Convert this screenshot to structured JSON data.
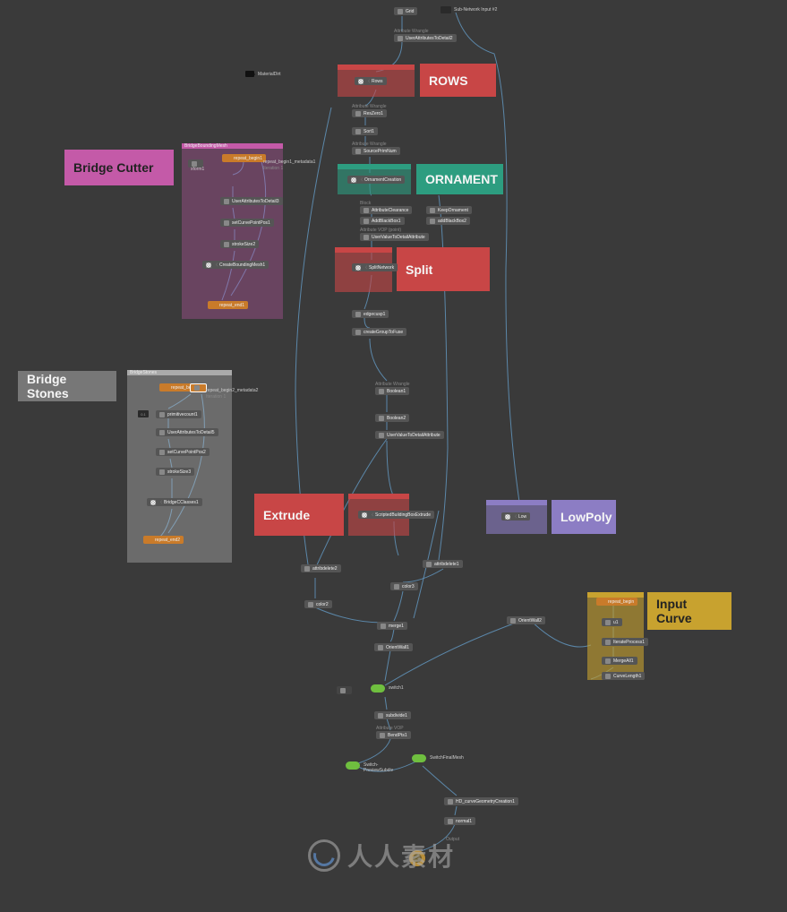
{
  "annotations": {
    "bridge_cutter": "Bridge Cutter",
    "bridge_stones": "Bridge Stones",
    "rows": "ROWS",
    "ornament": "ORNAMENT",
    "split": "Split",
    "extrude": "Extrude",
    "lowpoly": "LowPoly",
    "input_curve": "Input Curve"
  },
  "netbox_titles": {
    "bridge_bounding_mesh": "BridgeBoundingMesh",
    "bridge_stones": "BridgeStones",
    "rows_box": "",
    "ornament_box": "",
    "split_box": "",
    "extrude_l": "",
    "extrude_r": "",
    "lowpoly_box": "",
    "curve_box": ""
  },
  "nodes": {
    "grid": "Grid",
    "sub_input": "Sub-Network Input #2",
    "uva2detail1": "UserAttributesToDetail2",
    "rows": "Rows",
    "resize1": "Attribute Wrangle",
    "resize1b": "ResZero1",
    "sort1": "Sort1",
    "source_prim": "SourcePrimNum",
    "source_prim_lbl": "Attribute Wrangle",
    "ornament_creation": "OrnamentCreation",
    "attribute_clearance": "AttributeClearance",
    "attribute_clearance_lbl": "Block",
    "add_block1": "AddBlackBox1",
    "uva2detail_orn": "UserValueToDetailAttribute",
    "uva2detail_orn_lbl": "Attribute VOP (point)",
    "keep_ornament": "KeepOrnament",
    "add_block2": "addBlackBox2",
    "split_network": "SplitNetwork",
    "edgecusp1": "edgecusp1",
    "createGroupToFuse": "createGroupToFuse",
    "boolean1": "Boolean1",
    "boolean1_lbl": "Attribute Wrangle",
    "boolean2": "Boolean2",
    "uva_bool": "UserValueToDetailAttribute",
    "stashbbe": "ScriptedBuildingBoxExtrude",
    "attribdelete1": "attribdelete1",
    "color2": "color2",
    "attribdelete2": "attribdelete2",
    "color3": "color3",
    "merge1": "merge1",
    "orient_wall1": "OrientWall1",
    "orient_wall2": "OrientWall2",
    "switch1": "switch1",
    "subdivide1": "subdivide1",
    "bend_pts1": "BendPts1",
    "bend_pts1_lbl": "Attribute VOP",
    "switch_preview": "Switch-PreviewSubdiv",
    "switch_final": "SwitchFinalMesh",
    "hdcurve": "HD_curveGeometryCreation1",
    "normal1": "normal1",
    "out_label": "Output",
    "low": "Low",
    "repeat_begin1": "repeat_begin1",
    "rb1_meta": "repeat_begin1_metadata1",
    "rb1_iter": "Iteration 1",
    "xform1": "xform1",
    "uva2detail3": "UserAttributesToDetail3",
    "setcurvepoint1": "setCurvePointPos1",
    "strokesize2": "strokeSize2",
    "createBBmesh": "CreateBoundingMesh1",
    "repeat_end1": "repeat_end1",
    "repeat_begin2": "repeat_begin2",
    "rb2_meta": "repeat_begin2_metadata2",
    "rb2_iter": "Iteration 1",
    "primcount1": "primitivecount1",
    "uva2detail5": "UserAttributesToDetail5",
    "setcurvepoint2": "setCurvePointPos2",
    "strokesize3": "strokeSize3",
    "bridgeclasses": "BridgeCClasses1",
    "repeat_end2": "repeat_end2",
    "cv_repeat_begin": "repeat_begin",
    "cv_u1": "u1",
    "cv_iterprocess": "IterateProcess1",
    "cv_mergeall": "MergeAll1",
    "cv_curvelength": "CurveLength1",
    "camera_lbl": "MaterialDirt",
    "sticker_label": "0.1"
  },
  "watermark": "人人素材"
}
